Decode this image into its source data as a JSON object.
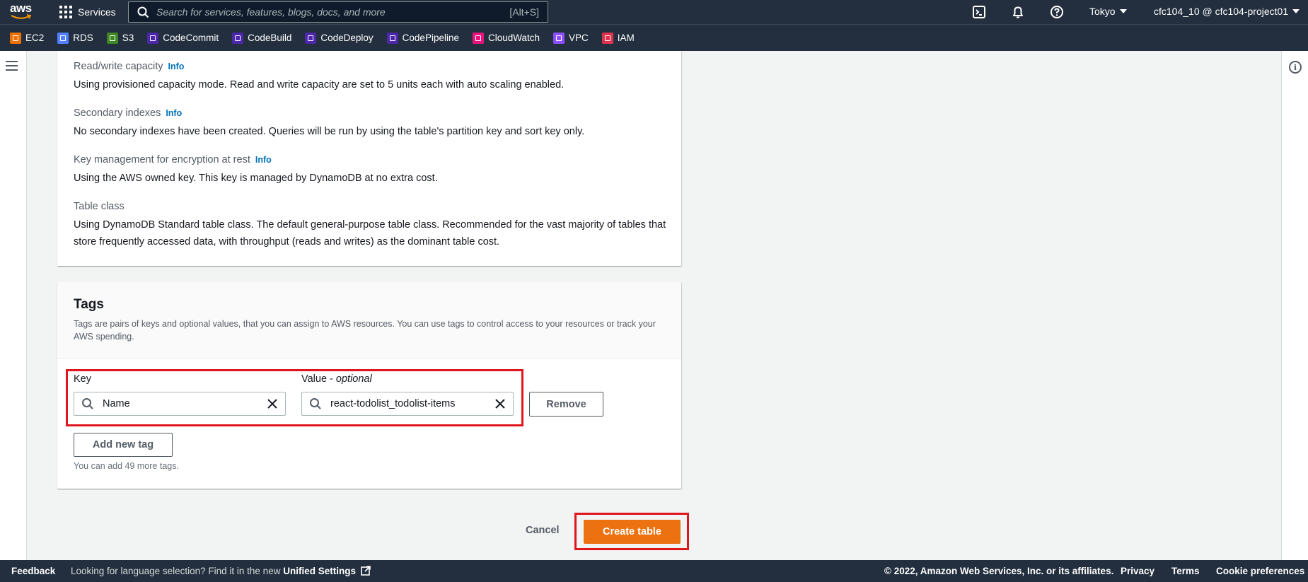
{
  "topnav": {
    "logo_text": "aws",
    "services_label": "Services",
    "search_placeholder": "Search for services, features, blogs, docs, and more",
    "search_shortcut": "[Alt+S]",
    "region": "Tokyo",
    "account": "cfc104_10 @ cfc104-project01"
  },
  "favorites": [
    {
      "label": "EC2",
      "color": "#ed7100"
    },
    {
      "label": "RDS",
      "color": "#527fff"
    },
    {
      "label": "S3",
      "color": "#3f8624"
    },
    {
      "label": "CodeCommit",
      "color": "#4d27aa"
    },
    {
      "label": "CodeBuild",
      "color": "#4d27aa"
    },
    {
      "label": "CodeDeploy",
      "color": "#4d27aa"
    },
    {
      "label": "CodePipeline",
      "color": "#4d27aa"
    },
    {
      "label": "CloudWatch",
      "color": "#e7157b"
    },
    {
      "label": "VPC",
      "color": "#8c4fff"
    },
    {
      "label": "IAM",
      "color": "#dd344c"
    }
  ],
  "settings": {
    "rw_label": "Read/write capacity",
    "rw_info": "Info",
    "rw_value": "Using provisioned capacity mode. Read and write capacity are set to 5 units each with auto scaling enabled.",
    "si_label": "Secondary indexes",
    "si_info": "Info",
    "si_value": "No secondary indexes have been created. Queries will be run by using the table's partition key and sort key only.",
    "km_label": "Key management for encryption at rest",
    "km_info": "Info",
    "km_value": "Using the AWS owned key. This key is managed by DynamoDB at no extra cost.",
    "tc_label": "Table class",
    "tc_value": "Using DynamoDB Standard table class. The default general-purpose table class. Recommended for the vast majority of tables that store frequently accessed data, with throughput (reads and writes) as the dominant table cost."
  },
  "tags": {
    "title": "Tags",
    "description": "Tags are pairs of keys and optional values, that you can assign to AWS resources. You can use tags to control access to your resources or track your AWS spending.",
    "key_label": "Key",
    "value_label": "Value - ",
    "value_label_optional": "optional",
    "key_value": "Name",
    "value_value": "react-todolist_todolist-items",
    "remove_label": "Remove",
    "add_label": "Add new tag",
    "hint": "You can add 49 more tags."
  },
  "actions": {
    "cancel": "Cancel",
    "create": "Create table"
  },
  "footer": {
    "feedback": "Feedback",
    "lang_text": "Looking for language selection? Find it in the new ",
    "lang_link": "Unified Settings",
    "copyright": "© 2022, Amazon Web Services, Inc. or its affiliates.",
    "privacy": "Privacy",
    "terms": "Terms",
    "cookies": "Cookie preferences"
  },
  "colors": {
    "nav_bg": "#232f3e",
    "accent_orange": "#ec7211",
    "link_blue": "#0073bb",
    "highlight_red": "#e0161e"
  }
}
